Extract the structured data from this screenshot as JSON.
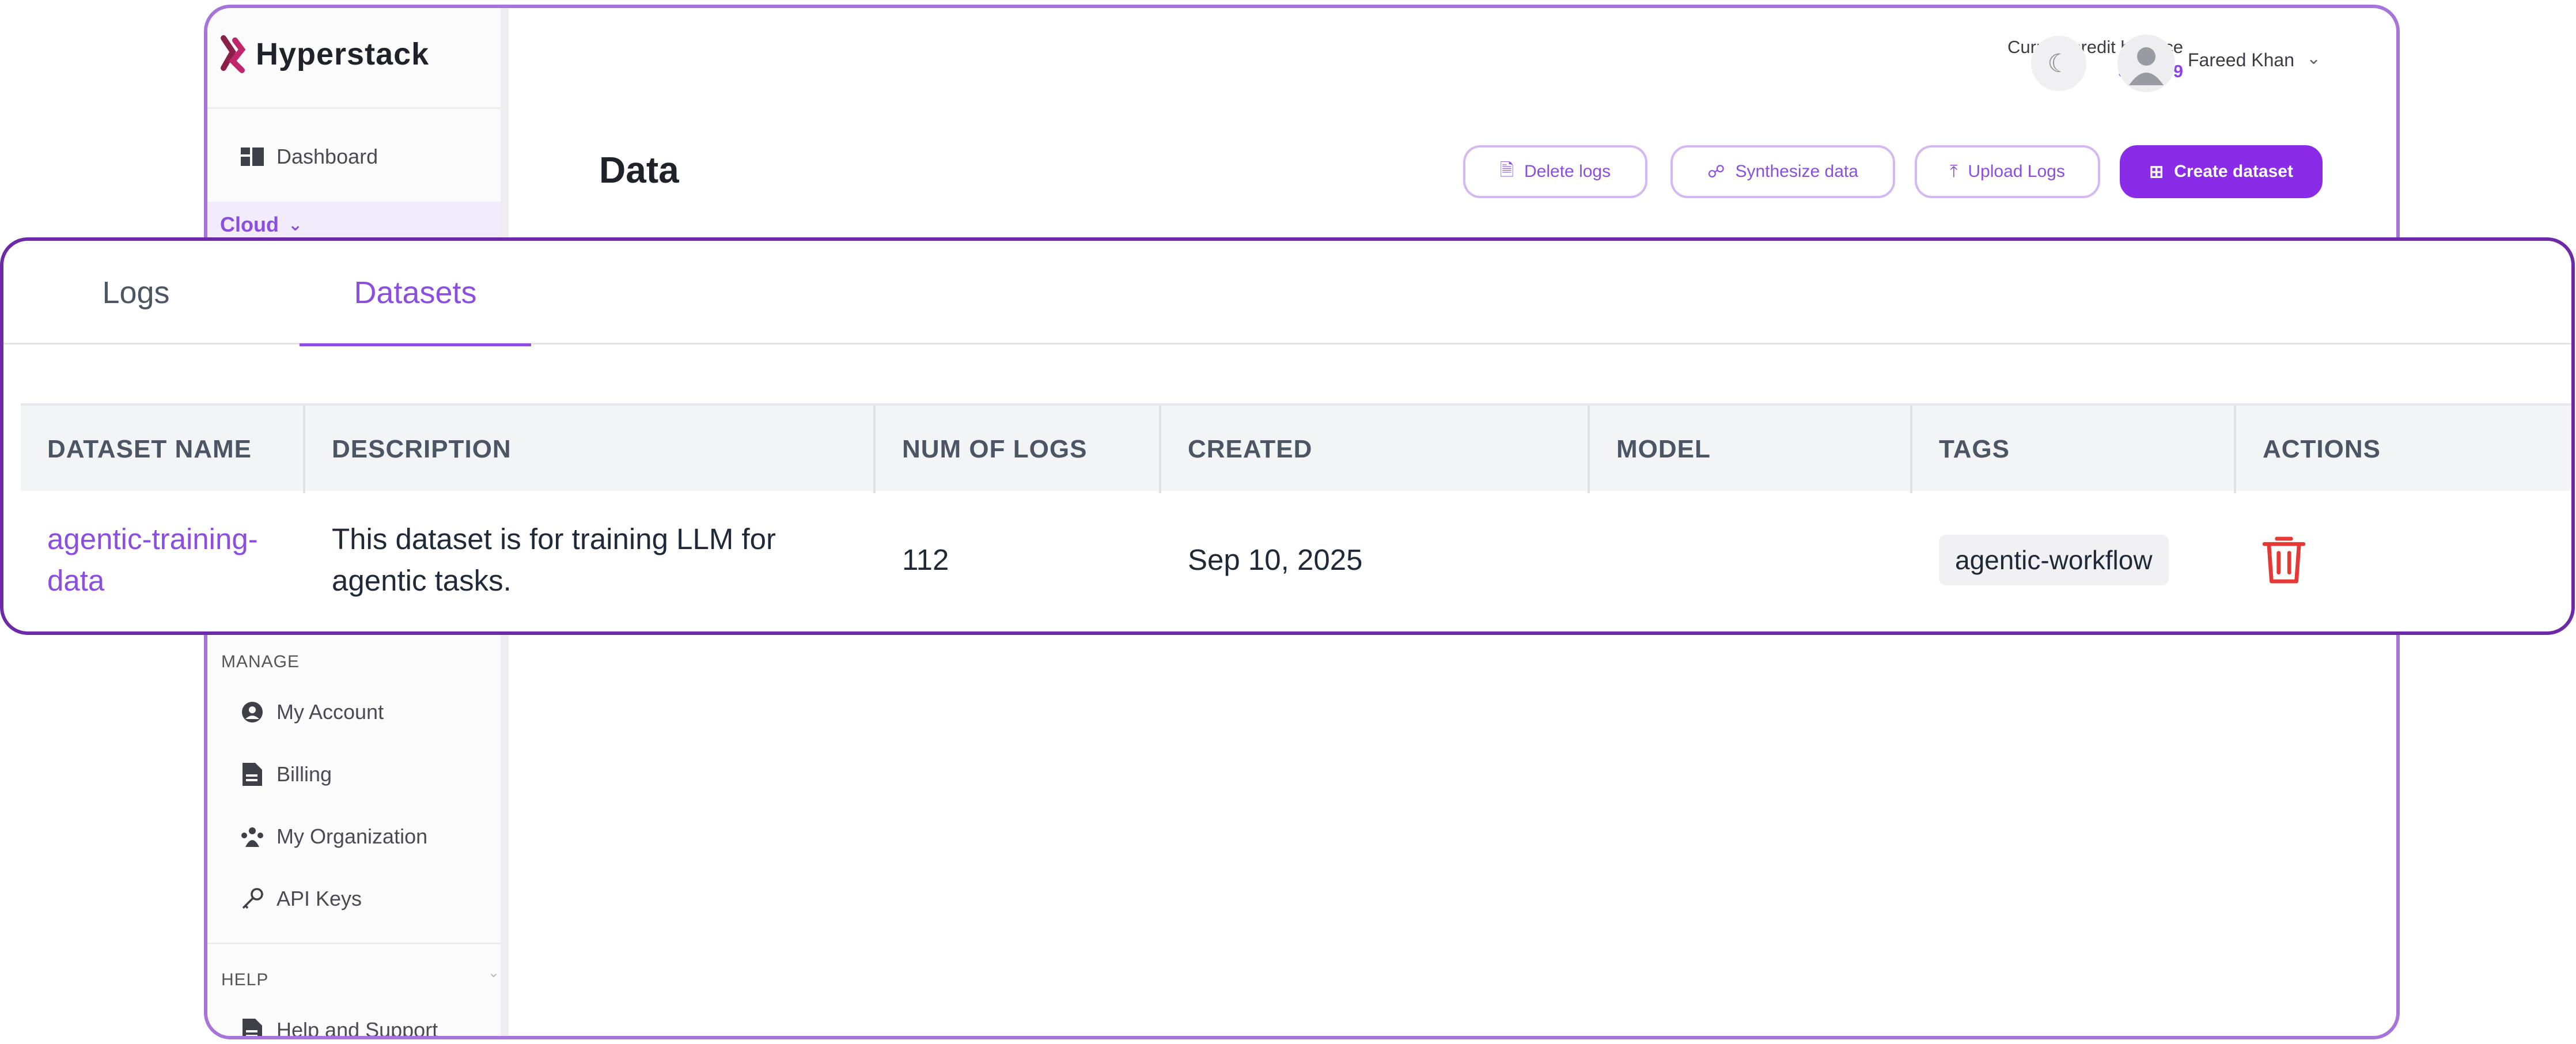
{
  "app": {
    "brand": "Hyperstack",
    "page_title": "Data",
    "brand_color": "#8a2be8"
  },
  "sidebar": {
    "dashboard_label": "Dashboard",
    "cloud_label": "Cloud",
    "manage_section": "MANAGE",
    "manage_items": [
      {
        "label": "My Account",
        "icon": "user-circle-icon"
      },
      {
        "label": "Billing",
        "icon": "document-icon"
      },
      {
        "label": "My Organization",
        "icon": "organization-icon"
      },
      {
        "label": "API Keys",
        "icon": "key-icon"
      }
    ],
    "help_section": "HELP",
    "help_items": [
      {
        "label": "Help and Support",
        "icon": "document-icon"
      }
    ]
  },
  "header": {
    "credit_label": "Current credit balance",
    "credit_value": "$174.59",
    "user_name": "Fareed Khan"
  },
  "actions": {
    "delete_logs": "Delete logs",
    "synthesize_data": "Synthesize data",
    "upload_logs": "Upload Logs",
    "create_dataset": "Create dataset"
  },
  "tabs": {
    "logs": "Logs",
    "datasets": "Datasets",
    "active": "Datasets"
  },
  "table": {
    "columns": [
      "DATASET NAME",
      "DESCRIPTION",
      "NUM OF LOGS",
      "CREATED",
      "MODEL",
      "TAGS",
      "ACTIONS"
    ],
    "rows": [
      {
        "name": "agentic-training-data",
        "description": "This dataset is for training LLM for agentic tasks.",
        "num_logs": "112",
        "created": "Sep 10, 2025",
        "model": "",
        "tags": [
          "agentic-workflow"
        ],
        "action_icon": "trash-icon"
      }
    ]
  }
}
